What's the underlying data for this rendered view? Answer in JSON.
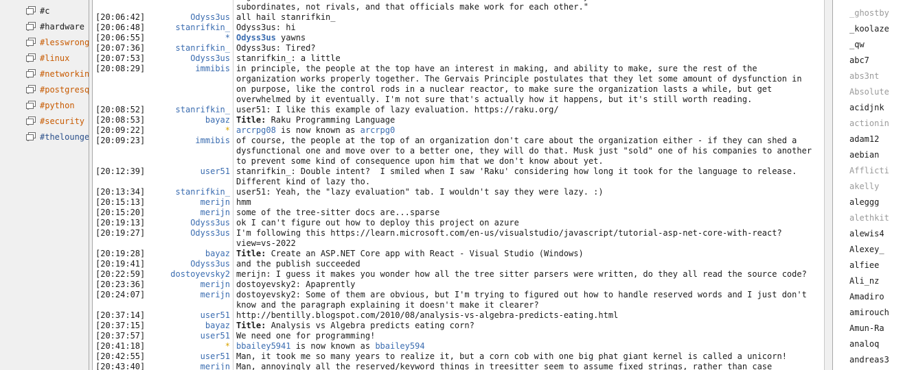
{
  "sidebar": {
    "channels": [
      {
        "name": "#c",
        "state": "normal"
      },
      {
        "name": "#hardware",
        "state": "normal"
      },
      {
        "name": "#lesswrong",
        "state": "highlight"
      },
      {
        "name": "#linux",
        "state": "highlight"
      },
      {
        "name": "#networking",
        "state": "highlight"
      },
      {
        "name": "#postgresql",
        "state": "highlight"
      },
      {
        "name": "#python",
        "state": "highlight"
      },
      {
        "name": "#security",
        "state": "highlight"
      },
      {
        "name": "#thelounge",
        "state": "active"
      }
    ]
  },
  "messages": [
    {
      "time": "",
      "nick": "",
      "type": "msg",
      "parts": [
        {
          "t": "regardless of the amount of work to be done. This was attributed mainly to two factors: that officials want subordinates, not rivals, and that officials make work for each other.\""
        }
      ]
    },
    {
      "time": "[20:06:42]",
      "nick": "Odyss3us",
      "type": "msg",
      "parts": [
        {
          "t": "all hail stanrifkin_"
        }
      ]
    },
    {
      "time": "[20:06:48]",
      "nick": "stanrifkin_",
      "type": "msg",
      "parts": [
        {
          "t": "Odyss3us: hi"
        }
      ]
    },
    {
      "time": "[20:06:55]",
      "nick": "*",
      "type": "action",
      "parts": [
        {
          "t": "Odyss3us",
          "s": "actnick"
        },
        {
          "t": " yawns"
        }
      ]
    },
    {
      "time": "[20:07:36]",
      "nick": "stanrifkin_",
      "type": "msg",
      "parts": [
        {
          "t": "Odyss3us: Tired?"
        }
      ]
    },
    {
      "time": "[20:07:53]",
      "nick": "Odyss3us",
      "type": "msg",
      "parts": [
        {
          "t": "stanrifkin_: a little"
        }
      ]
    },
    {
      "time": "[20:08:29]",
      "nick": "immibis",
      "type": "msg",
      "parts": [
        {
          "t": "in principle, the people at the top have an interest in making, and ability to make, sure the rest of the organization works properly together. The Gervais Principle postulates that they let some amount of dysfunction in on purpose, like the control rods in a nuclear reactor, to make sure the organization lasts a while, but get overwhelmed by it eventually. I'm not sure that's actually how it happens, but it's still worth reading."
        }
      ]
    },
    {
      "time": "[20:08:52]",
      "nick": "stanrifkin_",
      "type": "msg",
      "parts": [
        {
          "t": "user51: I like this example of lazy evaluation. https://raku.org/"
        }
      ]
    },
    {
      "time": "[20:08:53]",
      "nick": "bayaz",
      "type": "msg",
      "parts": [
        {
          "t": "Title:",
          "s": "bold"
        },
        {
          "t": " Raku Programming Language"
        }
      ]
    },
    {
      "time": "[20:09:22]",
      "nick": "*",
      "type": "join",
      "parts": [
        {
          "t": "arcrpg08",
          "s": "renick"
        },
        {
          "t": " is now known as "
        },
        {
          "t": "arcrpg0",
          "s": "renick"
        }
      ]
    },
    {
      "time": "[20:09:23]",
      "nick": "immibis",
      "type": "msg",
      "parts": [
        {
          "t": "of course, the people at the top of an organization don't care about the organization either - if they can shed a dysfunctional one and move over to a better one, they will do that. Musk just \"sold\" one of his companies to another to prevent some kind of consequence upon him that we don't know about yet."
        }
      ]
    },
    {
      "time": "[20:12:39]",
      "nick": "user51",
      "type": "msg",
      "parts": [
        {
          "t": "stanrifkin_: Double intent?  I smiled when I saw 'Raku' considering how long it took for the language to release. Different kind of lazy tho."
        }
      ]
    },
    {
      "time": "[20:13:34]",
      "nick": "stanrifkin_",
      "type": "msg",
      "parts": [
        {
          "t": "user51: Yeah, the \"lazy evaluation\" tab. I wouldn't say they were lazy. :)"
        }
      ]
    },
    {
      "time": "[20:15:13]",
      "nick": "merijn",
      "type": "msg",
      "parts": [
        {
          "t": "hmm"
        }
      ]
    },
    {
      "time": "[20:15:20]",
      "nick": "merijn",
      "type": "msg",
      "parts": [
        {
          "t": "some of the tree-sitter docs are...sparse"
        }
      ]
    },
    {
      "time": "[20:19:13]",
      "nick": "Odyss3us",
      "type": "msg",
      "parts": [
        {
          "t": "ok I can't figure out how to deploy this project on azure"
        }
      ]
    },
    {
      "time": "[20:19:27]",
      "nick": "Odyss3us",
      "type": "msg",
      "parts": [
        {
          "t": "I'm following this https://learn.microsoft.com/en-us/visualstudio/javascript/tutorial-asp-net-core-with-react?view=vs-2022"
        }
      ]
    },
    {
      "time": "[20:19:28]",
      "nick": "bayaz",
      "type": "msg",
      "parts": [
        {
          "t": "Title:",
          "s": "bold"
        },
        {
          "t": " Create an ASP.NET Core app with React - Visual Studio (Windows)"
        }
      ]
    },
    {
      "time": "[20:19:41]",
      "nick": "Odyss3us",
      "type": "msg",
      "parts": [
        {
          "t": "and the publish succeeded"
        }
      ]
    },
    {
      "time": "[20:22:59]",
      "nick": "dostoyevsky2",
      "type": "msg",
      "parts": [
        {
          "t": "merijn: I guess it makes you wonder how all the tree sitter parsers were written, do they all read the source code?"
        }
      ]
    },
    {
      "time": "[20:23:36]",
      "nick": "merijn",
      "type": "msg",
      "parts": [
        {
          "t": "dostoyevsky2: Apaprently"
        }
      ]
    },
    {
      "time": "[20:24:07]",
      "nick": "merijn",
      "type": "msg",
      "parts": [
        {
          "t": "dostoyevsky2: Some of them are obvious, but I'm trying to figured out how to handle reserved words and I just don't know and the paragraph explaining it doesn't make it clearer?"
        }
      ]
    },
    {
      "time": "[20:37:14]",
      "nick": "user51",
      "type": "msg",
      "parts": [
        {
          "t": "http://bentilly.blogspot.com/2010/08/analysis-vs-algebra-predicts-eating.html"
        }
      ]
    },
    {
      "time": "[20:37:15]",
      "nick": "bayaz",
      "type": "msg",
      "parts": [
        {
          "t": "Title:",
          "s": "bold"
        },
        {
          "t": " Analysis vs Algebra predicts eating corn?"
        }
      ]
    },
    {
      "time": "[20:37:57]",
      "nick": "user51",
      "type": "msg",
      "parts": [
        {
          "t": "We need one for programming!"
        }
      ]
    },
    {
      "time": "[20:41:18]",
      "nick": "*",
      "type": "join",
      "parts": [
        {
          "t": "bbailey5941",
          "s": "renick"
        },
        {
          "t": " is now known as "
        },
        {
          "t": "bbailey594",
          "s": "renick"
        }
      ]
    },
    {
      "time": "[20:42:55]",
      "nick": "user51",
      "type": "msg",
      "parts": [
        {
          "t": "Man, it took me so many years to realize it, but a corn cob with one big phat giant kernel is called a unicorn!"
        }
      ]
    },
    {
      "time": "[20:43:40]",
      "nick": "merijn",
      "type": "msg",
      "parts": [
        {
          "t": "Man, annoyingly all the reserved/keyword things in treesitter seem to assume fixed strings, rather than case"
        }
      ]
    }
  ],
  "users": [
    {
      "name": "_ghostby",
      "away": true
    },
    {
      "name": "_koolaze",
      "away": false
    },
    {
      "name": "_qw",
      "away": false
    },
    {
      "name": "abc7",
      "away": false
    },
    {
      "name": "abs3nt",
      "away": true
    },
    {
      "name": "Absolute",
      "away": true
    },
    {
      "name": "acidjnk",
      "away": false
    },
    {
      "name": "actionin",
      "away": true
    },
    {
      "name": "adam12",
      "away": false
    },
    {
      "name": "aebian",
      "away": false
    },
    {
      "name": "Afflicti",
      "away": true
    },
    {
      "name": "akelly",
      "away": true
    },
    {
      "name": "aleggg",
      "away": false
    },
    {
      "name": "alethkit",
      "away": true
    },
    {
      "name": "alewis4",
      "away": false
    },
    {
      "name": "Alexey_",
      "away": false
    },
    {
      "name": "alfiee",
      "away": false
    },
    {
      "name": "Ali_nz",
      "away": false
    },
    {
      "name": "Amadiro",
      "away": false
    },
    {
      "name": "amirouch",
      "away": false
    },
    {
      "name": "Amun-Ra",
      "away": false
    },
    {
      "name": "analoq",
      "away": false
    },
    {
      "name": "andreas3",
      "away": false
    }
  ]
}
